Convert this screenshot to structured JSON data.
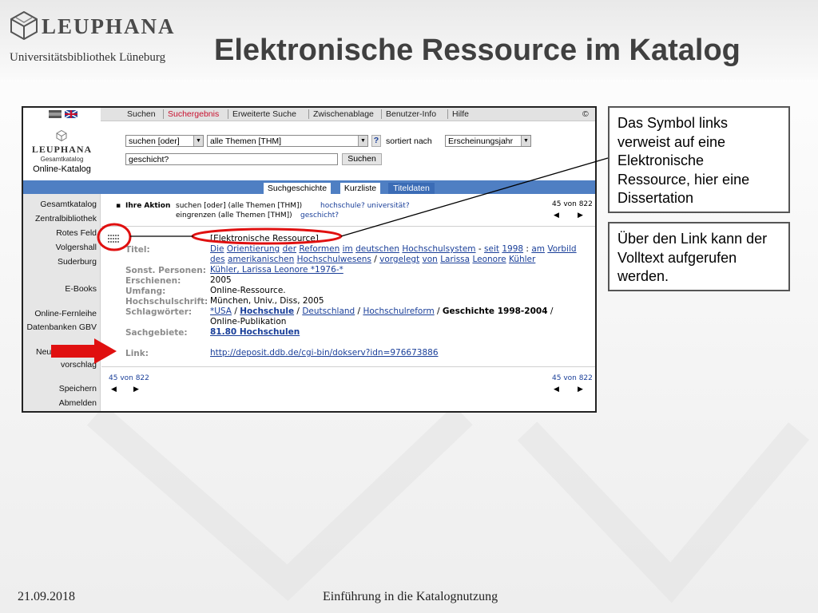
{
  "slide": {
    "brand": "LEUPHANA",
    "subtitle": "Universitätsbibliothek Lüneburg",
    "title": "Elektronische Ressource im Katalog",
    "footer_date": "21.09.2018",
    "footer_topic": "Einführung in die Katalognutzung"
  },
  "callouts": [
    {
      "text": "Das Symbol links verweist auf eine Elektronische Ressource, hier eine Dissertation"
    },
    {
      "text": "Über den Link kann der Volltext aufgerufen werden."
    }
  ],
  "catalog": {
    "brand": "LEUPHANA",
    "gesamt": "Gesamtkatalog",
    "online": "Online-Katalog",
    "nav": [
      "Suchen",
      "Suchergebnis",
      "Erweiterte Suche",
      "Zwischenablage",
      "Benutzer-Info",
      "Hilfe"
    ],
    "copyright": "©",
    "search": {
      "mode": "suchen [oder]",
      "field": "alle Themen [THM]",
      "help": "?",
      "sort_label": "sortiert nach",
      "sort_value": "Erscheinungsjahr",
      "query": "geschicht?",
      "button": "Suchen"
    },
    "tabs": [
      "Suchgeschichte",
      "Kurzliste",
      "Titeldaten"
    ],
    "sidebar": [
      "Gesamtkatalog",
      "Zentralbibliothek",
      "Rotes Feld",
      "Volgershall",
      "Suderburg",
      "E-Books",
      "Online-Fernleihe",
      "Datenbanken GBV",
      "Neu",
      "vorschlag",
      "Speichern",
      "Abmelden"
    ],
    "action": {
      "label": "Ihre Aktion",
      "line1_plain": "suchen [oder] (alle Themen [THM])",
      "line1_link": "hochschule? universität?",
      "line2_plain": "eingrenzen (alle Themen [THM])",
      "line2_link": "geschicht?"
    },
    "paging": {
      "count": "45 von 822",
      "prev": "◀",
      "next": "▶"
    },
    "record": {
      "type": "[Elektronische Ressource]",
      "labels": {
        "title": "Titel:",
        "persons": "Sonst. Personen:",
        "published": "Erschienen:",
        "extent": "Umfang:",
        "thesis": "Hochschulschrift:",
        "keywords": "Schlagwörter:",
        "subjects": "Sachgebiete:",
        "link": "Link:"
      },
      "title_line1": [
        "Die",
        "Orientierung",
        "der",
        "Reformen",
        "im",
        "deutschen",
        "Hochschulsystem",
        "-",
        "seit",
        "1998",
        ":",
        "am",
        "Vorbild"
      ],
      "title_line2": [
        "des",
        "amerikanischen",
        "Hochschulwesens",
        "/",
        "vorgelegt",
        "von",
        "Larissa",
        "Leonore",
        "Kühler"
      ],
      "persons": "Kühler, Larissa Leonore *1976-*",
      "published": "2005",
      "extent": "Online-Ressource.",
      "thesis": "München, Univ., Diss, 2005",
      "keywords_line1": {
        "k1": "*USA",
        "s1": "/",
        "k2": "Hochschule",
        "s2": "/",
        "k3": "Deutschland",
        "s3": "/",
        "k4": "Hochschulreform",
        "s4": "/",
        "k5": "Geschichte 1998-2004",
        "s5": "/"
      },
      "keywords_line2": "Online-Publikation",
      "subjects": "81.80 Hochschulen",
      "link": "http://deposit.ddb.de/cgi-bin/dokserv?idn=976673886"
    }
  },
  "colors": {
    "nav_active": "#c8102e",
    "tab_bar": "#4f7fc3",
    "link": "#1a3f99",
    "highlight": "#e01010",
    "arrow": "#e01010"
  }
}
